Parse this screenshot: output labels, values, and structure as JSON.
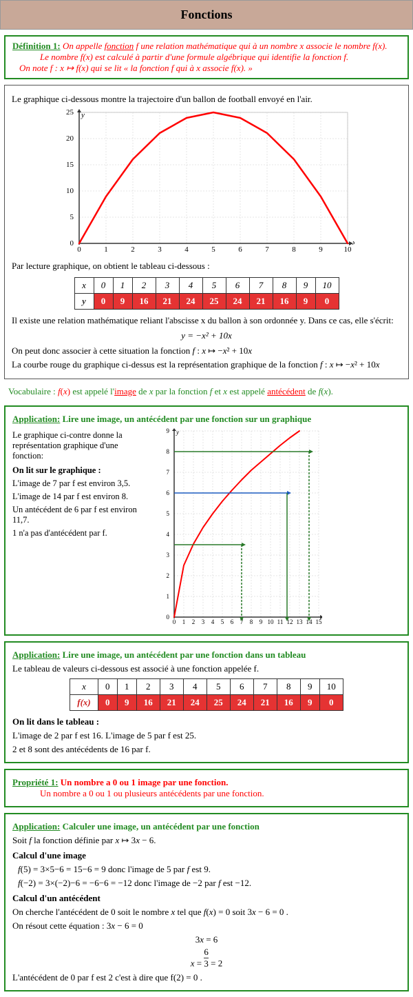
{
  "title": "Fonctions",
  "definition": {
    "label": "Définition 1:",
    "text1": "On appelle fonction f une relation mathématique qui à un nombre x associe le nombre f(x).",
    "text2": "Le nombre f(x) est calculé à partir d'une formule algébrique qui identifie la fonction f.",
    "text3": "On note f : x ↦ f(x)  qui se lit « la fonction f qui à x  associe f(x). »"
  },
  "section1": {
    "intro": "Le graphique ci-dessous montre la trajectoire d'un ballon de football envoyé en l'air.",
    "table_intro": "Par lecture graphique, on obtient le tableau ci-dessous :",
    "table_x": [
      0,
      1,
      2,
      3,
      4,
      5,
      6,
      7,
      8,
      9,
      10
    ],
    "table_y": [
      0,
      9,
      16,
      21,
      24,
      25,
      24,
      21,
      16,
      9,
      0
    ],
    "text1": "Il existe une relation mathématique reliant l'abscisse x du ballon à son ordonnée y. Dans ce cas, elle s'écrit:",
    "formula1": "y = −x² + 10x",
    "text2": "On peut donc associer à cette situation la fonction f :",
    "formula2": "x ↦ −x² + 10x",
    "text3": "La courbe rouge du graphique ci-dessus est la représentation graphique de la fonction f :",
    "formula3": "x ↦ −x² + 10x"
  },
  "vocab": {
    "text": "Vocabulaire : f(x) est appelé l'image de x par la fonction f et  x est appelé antécédent de f(x)."
  },
  "app1": {
    "title": "Application:",
    "subtitle": "Lire une image, un antécédent par une fonction sur un graphique",
    "text1": "Le graphique ci-contre donne la représentation graphique d'une fonction:",
    "bold1": "On lit sur le graphique :",
    "line1": "L'image de 7 par f est environ 3,5.",
    "line2": "L'image de 14 par f est environ 8.",
    "line3": "Un antécédent de 6 par f est environ 11,7.",
    "line4": "1 n'a pas d'antécédent par f."
  },
  "app2": {
    "title": "Application:",
    "subtitle": "Lire une image, un antécédent par une fonction dans un tableau",
    "intro": "Le tableau de valeurs ci-dessous est associé à une fonction appelée f.",
    "table_x": [
      0,
      1,
      2,
      3,
      4,
      5,
      6,
      7,
      8,
      9,
      10
    ],
    "table_fx": [
      0,
      9,
      16,
      21,
      24,
      25,
      24,
      21,
      16,
      9,
      0
    ],
    "bold1": "On lit dans le tableau :",
    "line1": "L'image de 2 par f est 16. L'image de 5 par f est 25.",
    "line2": "2 et 8 sont des antécédents de 16 par f."
  },
  "prop1": {
    "label": "Propriété 1:",
    "text1": "Un nombre a  0  ou 1 image par une fonction.",
    "text2": "Un nombre a  0  ou 1 ou plusieurs antécédents par une fonction."
  },
  "app3": {
    "title": "Application:",
    "subtitle": "Calculer une image, un antécédent par une fonction",
    "intro": "Soit f  la fonction définie par  x ↦ 3x − 6.",
    "bold1": "Calcul d'une image",
    "calc1": "f(5) = 3×5−6 = 15−6 = 9  donc l'image de 5 par f est 9.",
    "calc2": "f(−2) = 3×(−2)−6 = −6−6 = −12  donc l'image de −2 par f est −12.",
    "bold2": "Calcul d'un antécédent",
    "antec1": "On cherche l'antécédent de 0 soit le nombre x tel que f(x) = 0  soit  3x − 6 = 0 .",
    "antec2": "On résout cette équation :  3x − 6 = 0",
    "antec3": "3x = 6",
    "antec4": "x = 6/3 = 2",
    "antec5": "L'antécédent de 0 par f est 2 c'est à dire que f(2) = 0 ."
  }
}
